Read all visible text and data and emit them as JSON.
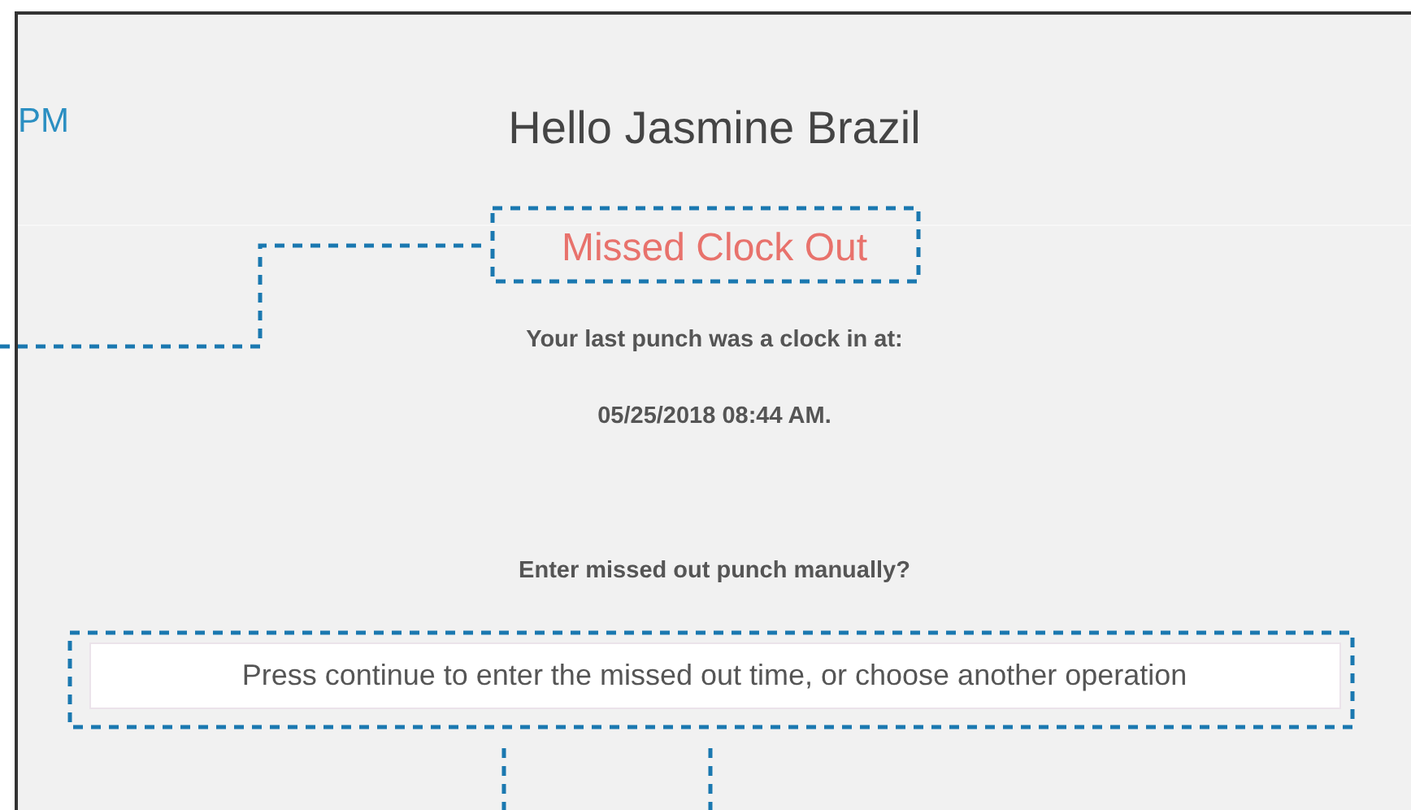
{
  "header": {
    "time_fragment": "PM",
    "greeting": "Hello Jasmine Brazil"
  },
  "status": {
    "title": "Missed Clock Out",
    "last_punch_label": "Your last punch was a clock in at:",
    "last_punch_time": "05/25/2018 08:44 AM.",
    "question": "Enter missed out punch manually?",
    "message": "Press continue to enter the missed out time, or choose another operation"
  }
}
